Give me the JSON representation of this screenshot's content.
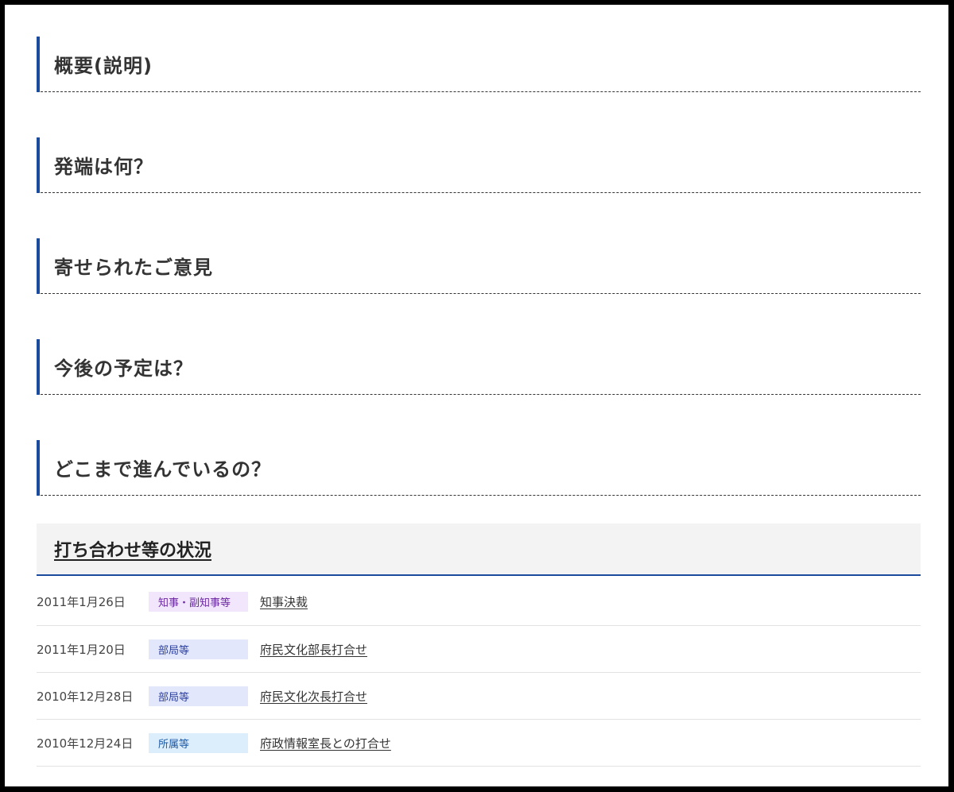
{
  "sections": [
    {
      "title": "概要(説明)"
    },
    {
      "title": "発端は何？"
    },
    {
      "title": "寄せられたご意見"
    },
    {
      "title": "今後の予定は？"
    },
    {
      "title": "どこまで進んでいるの？"
    }
  ],
  "status": {
    "title": "打ち合わせ等の状況",
    "rows": [
      {
        "date": "2011年1月26日",
        "category": "知事・副知事等",
        "link": "知事決裁"
      },
      {
        "date": "2011年1月20日",
        "category": "部局等",
        "link": "府民文化部長打合せ"
      },
      {
        "date": "2010年12月28日",
        "category": "部局等",
        "link": "府民文化次長打合せ"
      },
      {
        "date": "2010年12月24日",
        "category": "所属等",
        "link": "府政情報室長との打合せ"
      }
    ]
  },
  "colors": {
    "accent": "#1a4b9c",
    "badge_chiji": "#f1e6fb",
    "badge_bukyoku": "#e2e7fb",
    "badge_shozoku": "#dcedfb"
  }
}
